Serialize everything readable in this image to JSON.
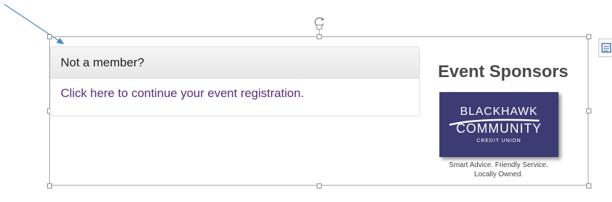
{
  "panel": {
    "heading": "Not a member?",
    "link_text": "Click here to continue your event registration."
  },
  "sponsors": {
    "heading": "Event Sponsors",
    "logo": {
      "line1": "BLACKHAWK",
      "line2": "COMMUNITY",
      "line3": "CREDIT UNION"
    },
    "tagline_line1": "Smart Advice. Friendly Service.",
    "tagline_line2": "Locally Owned."
  },
  "colors": {
    "link": "#5c2d7c",
    "logo_background": "#3d3b73",
    "arrow": "#4a86c8"
  },
  "icons": {
    "rotate": "rotate-handle-icon",
    "layout_options": "layout-options-icon"
  }
}
